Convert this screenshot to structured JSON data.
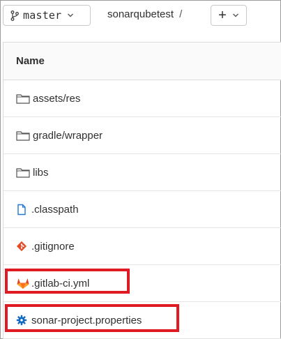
{
  "toolbar": {
    "branch": "master",
    "project": "sonarqubetest",
    "separator": "/",
    "add_label": "+"
  },
  "table": {
    "header": "Name",
    "rows": [
      {
        "name": "assets/res",
        "type": "folder"
      },
      {
        "name": "gradle/wrapper",
        "type": "folder"
      },
      {
        "name": "libs",
        "type": "folder"
      },
      {
        "name": ".classpath",
        "type": "file"
      },
      {
        "name": ".gitignore",
        "type": "git"
      },
      {
        "name": ".gitlab-ci.yml",
        "type": "gitlab"
      },
      {
        "name": "sonar-project.properties",
        "type": "settings"
      }
    ]
  },
  "colors": {
    "highlight": "#e01a22",
    "git": "#e24b29",
    "gitlab": "#e24329",
    "file_blue": "#1f78d1",
    "settings_blue": "#1068bf"
  }
}
